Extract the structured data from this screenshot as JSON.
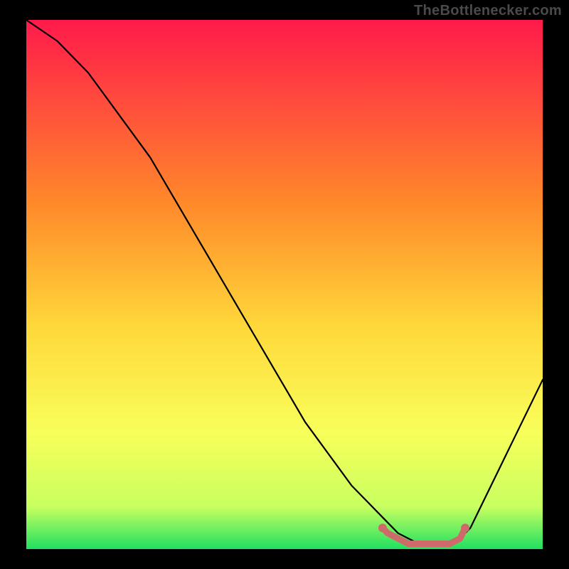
{
  "watermark": "TheBottlenecker.com",
  "colors": {
    "background": "#000000",
    "watermark_text": "#4a4a4a",
    "curve_stroke": "#000000",
    "marker_fill": "#cf6a6a",
    "gradient_top": "#ff1a4b",
    "gradient_mid_upper": "#ff8a2a",
    "gradient_mid": "#ffd83a",
    "gradient_mid_lower": "#f8ff5a",
    "gradient_lower": "#c8ff60",
    "gradient_bottom": "#20e060"
  },
  "chart_data": {
    "type": "line",
    "title": "",
    "xlabel": "",
    "ylabel": "",
    "xlim": [
      0,
      100
    ],
    "ylim": [
      0,
      100
    ],
    "grid": false,
    "legend": false,
    "annotations": [],
    "series": [
      {
        "name": "bottleneck-curve",
        "x": [
          0,
          3,
          6,
          9,
          12,
          15,
          18,
          21,
          24,
          27,
          30,
          33,
          36,
          39,
          42,
          45,
          48,
          51,
          54,
          57,
          60,
          63,
          66,
          68,
          70,
          72,
          74,
          76,
          78,
          80,
          82,
          84,
          86,
          88,
          90,
          92,
          94,
          96,
          98,
          100
        ],
        "y": [
          100,
          98,
          96,
          93,
          90,
          86,
          82,
          78,
          74,
          69,
          64,
          59,
          54,
          49,
          44,
          39,
          34,
          29,
          24,
          20,
          16,
          12,
          9,
          7,
          5,
          3,
          2,
          1,
          1,
          1,
          1,
          2,
          4,
          8,
          12,
          16,
          20,
          24,
          28,
          32
        ]
      }
    ],
    "highlight_band": {
      "name": "optimal-region",
      "x": [
        69,
        70,
        72,
        74,
        76,
        78,
        80,
        82,
        84,
        85
      ],
      "y": [
        4,
        3,
        2,
        1,
        1,
        1,
        1,
        1,
        2,
        4
      ]
    }
  }
}
